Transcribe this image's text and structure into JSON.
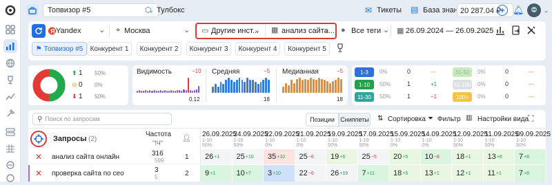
{
  "app": {
    "project": "Топвизор #5",
    "toolbox": "Тулбокс",
    "tickets": "Тикеты",
    "knowledge": "База знаний",
    "balance": "20 287.04 ₽"
  },
  "filters": {
    "engine": "Yandex",
    "region": "Москва",
    "other": "Другие инст...",
    "analysis": "анализ сайта...",
    "tags": "Все теги",
    "dates": "26.09.2024 — 26.09.2025"
  },
  "competitors": [
    "Топвизор #5",
    "Конкурент 1",
    "Конкурент 2",
    "Конкурент 3",
    "Конкурент 4",
    "Конкурент 5"
  ],
  "summary": {
    "up": {
      "value": "1",
      "pct": "50%"
    },
    "same": {
      "value": "0",
      "pct": "0%"
    },
    "down": {
      "value": "1",
      "pct": "50%"
    }
  },
  "metrics": [
    {
      "label": "Видимость",
      "delta": "−10",
      "value": "0.12",
      "bars": [
        2,
        3,
        2,
        2,
        3,
        2,
        3,
        2,
        3,
        2,
        2,
        3,
        2,
        3,
        2,
        2,
        3,
        2,
        2,
        3,
        3,
        2,
        4,
        3,
        16,
        3,
        2,
        3,
        4,
        7
      ]
    },
    {
      "label": "Средняя",
      "delta": "−5",
      "value": "18",
      "bars": [
        6,
        8,
        6,
        10,
        8,
        12,
        14,
        12,
        10,
        12,
        14,
        12,
        10,
        14,
        12,
        12,
        10,
        8,
        10,
        12,
        14,
        12
      ]
    },
    {
      "label": "Медианная",
      "delta": "−5",
      "value": "18",
      "bars": [
        6,
        9,
        7,
        12,
        9,
        13,
        14,
        12,
        13,
        12,
        14,
        13,
        12,
        14,
        13,
        12,
        11,
        9,
        11,
        12,
        14,
        13
      ]
    }
  ],
  "ranges": [
    {
      "label": "1-3",
      "color": "#2b73d9",
      "text": "#fff",
      "pct": "0%",
      "count": "0",
      "delta": "—"
    },
    {
      "label": "1-10",
      "color": "#21a24a",
      "text": "#fff",
      "pct": "50%",
      "count": "1",
      "delta": "+1"
    },
    {
      "label": "11-30",
      "color": "#2aa79b",
      "text": "#fff",
      "pct": "50%",
      "count": "1",
      "delta": "−1"
    },
    {
      "label": "31-50",
      "color": "#c8ecb6",
      "text": "#9ab",
      "pct": "0%",
      "count": "0",
      "delta": "—"
    },
    {
      "label": "51-100",
      "color": "#dcdfe4",
      "text": "#fff",
      "pct": "0%",
      "count": "0",
      "delta": "—"
    },
    {
      "label": "100+",
      "color": "#f6c343",
      "text": "#fff",
      "pct": "0%",
      "count": "0",
      "delta": "—"
    }
  ],
  "toolbar": {
    "search_placeholder": "Поиск по запросам",
    "positions": "Позиции",
    "snippets": "Сниппеты",
    "sort": "Сортировка",
    "filter": "Фильтр",
    "view": "Настройки вида"
  },
  "table": {
    "title": "Запросы",
    "count": "(2)",
    "freq_label": "Частота",
    "freq_sub": "\"!Ч\"",
    "dates": [
      "26.09.2025",
      "24.09.2025",
      "22.09.2025",
      "21.09.2025",
      "19.09.2025",
      "17.09.2025",
      "15.09.2025",
      "14.09.2025",
      "12.09.2025",
      "11.09.2025",
      "09.09.2025"
    ],
    "date_sub": "1-10",
    "date_pct": [
      "50%",
      "50%",
      "0%",
      "0%",
      "50%",
      "50%",
      "0%",
      "0%",
      "50%",
      "50%",
      "50%"
    ],
    "rows": [
      {
        "query": "анализ сайта онлайн",
        "freq": "316",
        "freq2": "599",
        "rank": "1",
        "cells": [
          {
            "v": "26",
            "d": "+1"
          },
          {
            "v": "25",
            "d": "+10"
          },
          {
            "v": "35",
            "d": "+10"
          },
          {
            "v": "25",
            "d": "−6"
          },
          {
            "v": "19",
            "d": "+6"
          },
          {
            "v": "25",
            "d": "−5"
          },
          {
            "v": "20",
            "d": "+5"
          },
          {
            "v": "10",
            "d": "−8"
          },
          {
            "v": "18",
            "d": "+1"
          },
          {
            "v": "13",
            "d": "+6"
          },
          {
            "v": "7",
            "d": "+6"
          }
        ]
      },
      {
        "query": "проверка сайта по сео",
        "freq": "3",
        "freq2": "5",
        "rank": "2",
        "cells": [
          {
            "v": "9",
            "d": "+1"
          },
          {
            "v": "10",
            "d": "+7"
          },
          {
            "v": "3",
            "d": "+10"
          },
          {
            "v": "22",
            "d": "−6"
          },
          {
            "v": "26",
            "d": "+19"
          },
          {
            "v": "7",
            "d": "+11"
          },
          {
            "v": "18",
            "d": "+5"
          },
          {
            "v": "13",
            "d": "+1"
          },
          {
            "v": "12",
            "d": "+1"
          },
          {
            "v": "11",
            "d": "+1"
          },
          {
            "v": "7",
            "d": "+6"
          }
        ]
      }
    ]
  }
}
